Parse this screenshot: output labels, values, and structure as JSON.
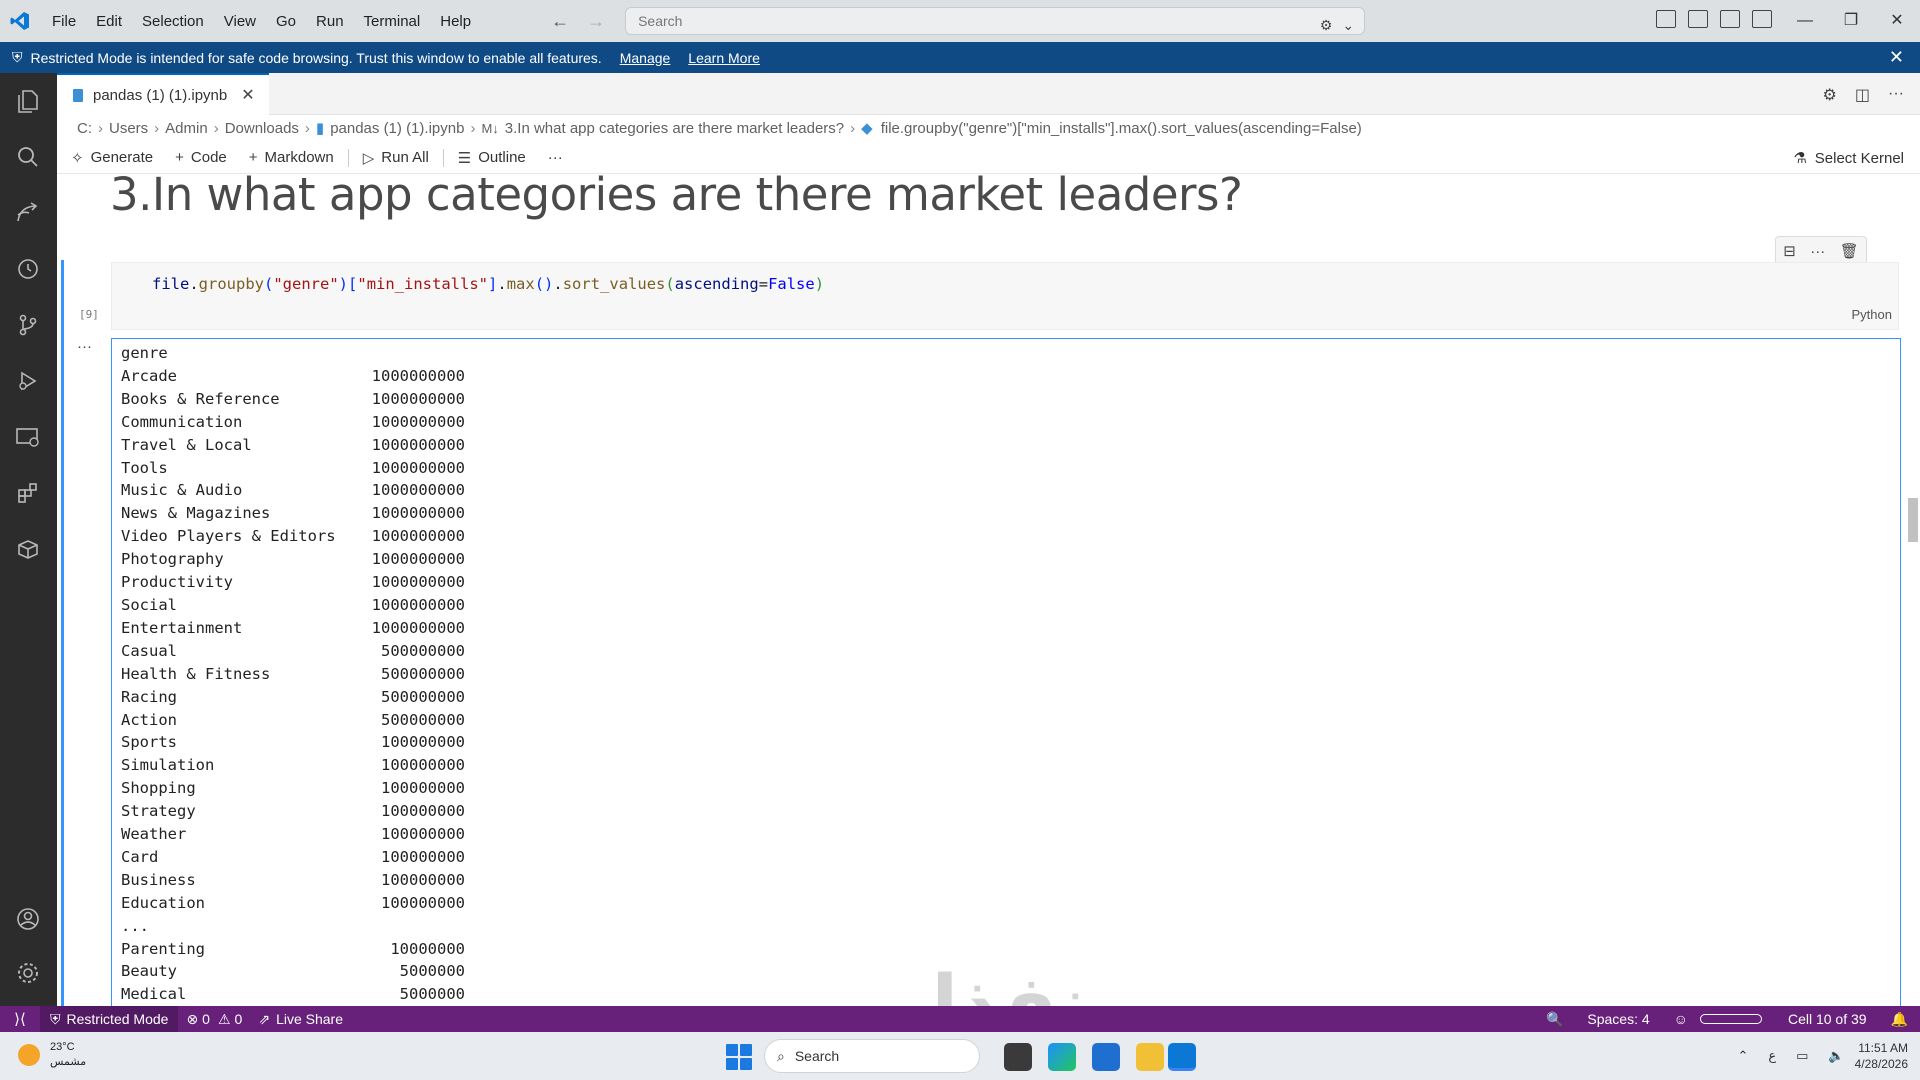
{
  "titlebar": {
    "menu": [
      "File",
      "Edit",
      "Selection",
      "View",
      "Go",
      "Run",
      "Terminal",
      "Help"
    ],
    "search_placeholder": "Search"
  },
  "banner": {
    "message": "Restricted Mode is intended for safe code browsing. Trust this window to enable all features.",
    "manage": "Manage",
    "learn_more": "Learn More"
  },
  "tab": {
    "title": "pandas (1) (1).ipynb"
  },
  "breadcrumb": [
    "C:",
    "Users",
    "Admin",
    "Downloads",
    "pandas (1) (1).ipynb",
    "3.In what app categories are there market leaders?",
    "file.groupby(\"genre\")[\"min_installs\"].max().sort_values(ascending=False)"
  ],
  "toolbar": {
    "generate": "Generate",
    "code": "Code",
    "markdown": "Markdown",
    "run_all": "Run All",
    "outline": "Outline",
    "more": "···",
    "select_kernel": "Select Kernel"
  },
  "notebook": {
    "heading": "3.In what app categories are there market leaders?",
    "code": {
      "file": "file",
      "groupby": "groupby",
      "genre_str": "\"genre\"",
      "min_installs_str": "\"min_installs\"",
      "max": "max",
      "sort_values": "sort_values",
      "ascending": "ascending",
      "false_kw": "False"
    },
    "language": "Python",
    "exec_count": "[9]",
    "output_header": "genre",
    "output_rows": [
      {
        "genre": "Arcade",
        "value": "1000000000"
      },
      {
        "genre": "Books & Reference",
        "value": "1000000000"
      },
      {
        "genre": "Communication",
        "value": "1000000000"
      },
      {
        "genre": "Travel & Local",
        "value": "1000000000"
      },
      {
        "genre": "Tools",
        "value": "1000000000"
      },
      {
        "genre": "Music & Audio",
        "value": "1000000000"
      },
      {
        "genre": "News & Magazines",
        "value": "1000000000"
      },
      {
        "genre": "Video Players & Editors",
        "value": "1000000000"
      },
      {
        "genre": "Photography",
        "value": "1000000000"
      },
      {
        "genre": "Productivity",
        "value": "1000000000"
      },
      {
        "genre": "Social",
        "value": "1000000000"
      },
      {
        "genre": "Entertainment",
        "value": "1000000000"
      },
      {
        "genre": "Casual",
        "value": "500000000"
      },
      {
        "genre": "Health & Fitness",
        "value": "500000000"
      },
      {
        "genre": "Racing",
        "value": "500000000"
      },
      {
        "genre": "Action",
        "value": "500000000"
      },
      {
        "genre": "Sports",
        "value": "100000000"
      },
      {
        "genre": "Simulation",
        "value": "100000000"
      },
      {
        "genre": "Shopping",
        "value": "100000000"
      },
      {
        "genre": "Strategy",
        "value": "100000000"
      },
      {
        "genre": "Weather",
        "value": "100000000"
      },
      {
        "genre": "Card",
        "value": "100000000"
      },
      {
        "genre": "Business",
        "value": "100000000"
      },
      {
        "genre": "Education",
        "value": "100000000"
      },
      {
        "genre": "...",
        "value": ""
      },
      {
        "genre": "Parenting",
        "value": "10000000"
      },
      {
        "genre": "Beauty",
        "value": "5000000"
      },
      {
        "genre": "Medical",
        "value": "5000000"
      }
    ]
  },
  "statusbar": {
    "restricted": "Restricted Mode",
    "errors": "0",
    "warnings": "0",
    "live_share": "Live Share",
    "spaces": "Spaces: 4",
    "cell_pos": "Cell 10 of 39"
  },
  "taskbar": {
    "temp": "23°C",
    "condition": "مشمس",
    "search": "Search",
    "time": "11:51 AM",
    "date": "4/28/2026",
    "lang": "ع"
  },
  "watermark": "نفذلي",
  "colors": {
    "accent": "#0066b8",
    "banner": "#0f4a85",
    "statusbar": "#68217a",
    "cell_focus": "#3794ff"
  }
}
